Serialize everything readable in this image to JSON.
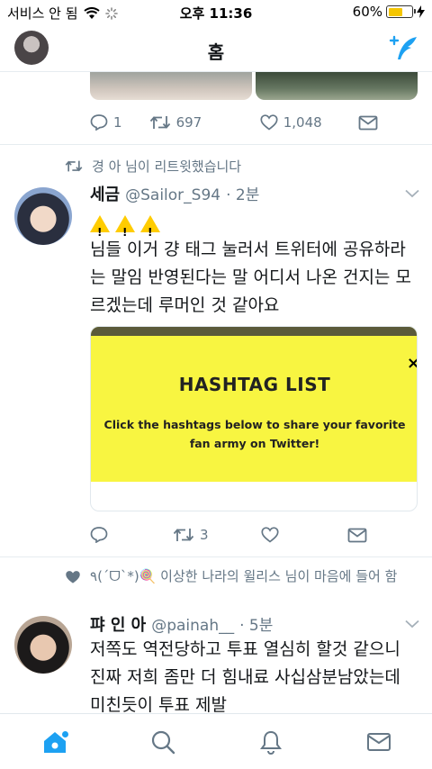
{
  "status_bar": {
    "carrier": "서비스 안 됨",
    "time": "오후 11:36",
    "battery_percent": "60%",
    "battery_level": 0.6
  },
  "header": {
    "title": "홈"
  },
  "tweet0": {
    "reply_count": "1",
    "retweet_count": "697",
    "like_count": "1,048"
  },
  "tweet1": {
    "context": "경 아 님이 리트윗했습니다",
    "name": "세금",
    "handle": "@Sailor_S94",
    "time": "· 2분",
    "text": "님들 이거 걍 태그 눌러서 트위터에 공유하라는 말임 반영된다는 말 어디서 나온 건지는 모르겠는데 루머인 것 같아요",
    "card": {
      "title": "HASHTAG LIST",
      "text": "Click the hashtags below to share your favorite fan army on Twitter!",
      "close": "×"
    },
    "retweet_count": "3"
  },
  "tweet2": {
    "context": "٩(´ᗜ`*)🍭 이상한 나라의 윌리스 님이 마음에 들어 함",
    "name": "퍄 인 아",
    "handle": "@painah__",
    "time": "· 5분",
    "text": "저쪽도 역전당하고 투표 열심히 할것 같으니 진짜 저희 좀만 더 힘내료 사십삼분남았는데 미친듯이 투표 제발"
  },
  "colors": {
    "accent": "#1da1f2",
    "muted": "#657786",
    "card_yellow": "#f8f541"
  },
  "icons": [
    "wifi-icon",
    "loading-icon",
    "charging-icon",
    "compose-icon",
    "reply-icon",
    "retweet-icon",
    "like-icon",
    "dm-icon",
    "home-icon",
    "search-icon",
    "notifications-icon",
    "messages-icon",
    "chevron-down-icon",
    "warning-icon"
  ]
}
